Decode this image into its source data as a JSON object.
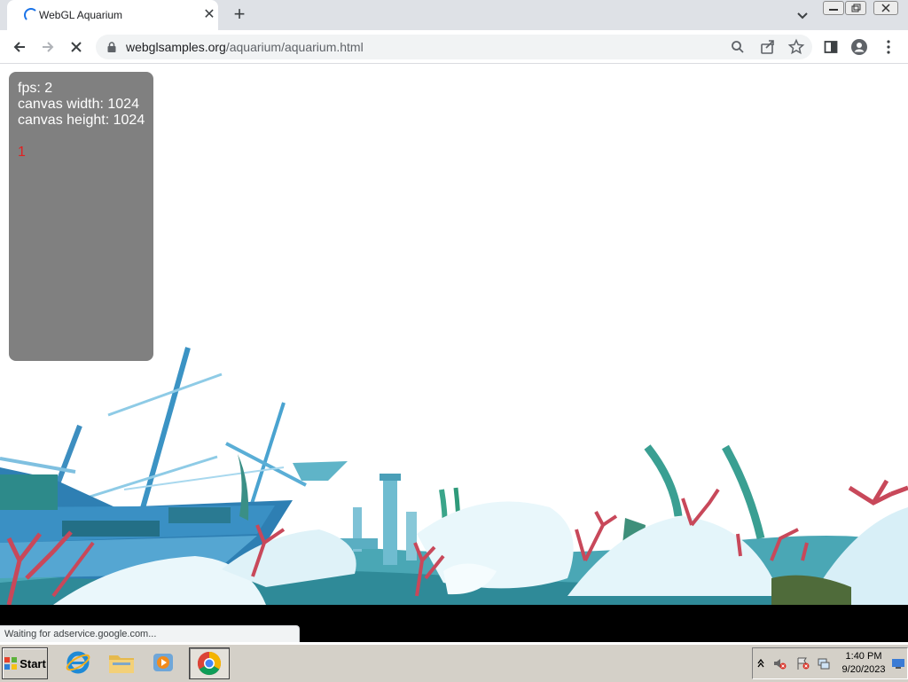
{
  "browser": {
    "tab": {
      "title": "WebGL Aquarium",
      "close": "✕"
    },
    "new_tab": "+",
    "address": {
      "host": "webglsamples.org",
      "path": "/aquarium/aquarium.html"
    },
    "status_bubble": "Waiting for adservice.google.com..."
  },
  "page": {
    "stats": {
      "fps": "fps: 2",
      "canvas_width": "canvas width: 1024",
      "canvas_height": "canvas height: 1024",
      "count": "1"
    }
  },
  "taskbar": {
    "start_label": "Start",
    "clock": {
      "time": "1:40 PM",
      "date": "9/20/2023"
    }
  },
  "icons": {
    "tab": [
      "loading-spinner-icon",
      "close-icon",
      "plus-icon",
      "chevron-down-icon"
    ],
    "toolbar": [
      "back-arrow-icon",
      "forward-arrow-icon",
      "stop-loading-icon",
      "lock-icon",
      "search-icon",
      "share-icon",
      "star-icon",
      "side-panel-icon",
      "profile-icon",
      "more-menu-icon"
    ],
    "taskbar": [
      "windows-logo-icon",
      "internet-explorer-icon",
      "folder-icon",
      "media-player-icon",
      "chrome-icon",
      "tray-chevron-icon",
      "volume-muted-icon",
      "flag-alert-icon",
      "network-icon",
      "desktop-icon"
    ]
  },
  "colors": {
    "accent": "#1a73e8",
    "stats_panel": "#808080",
    "water_light": "#bfe8f2",
    "coral": "#c8485a"
  }
}
